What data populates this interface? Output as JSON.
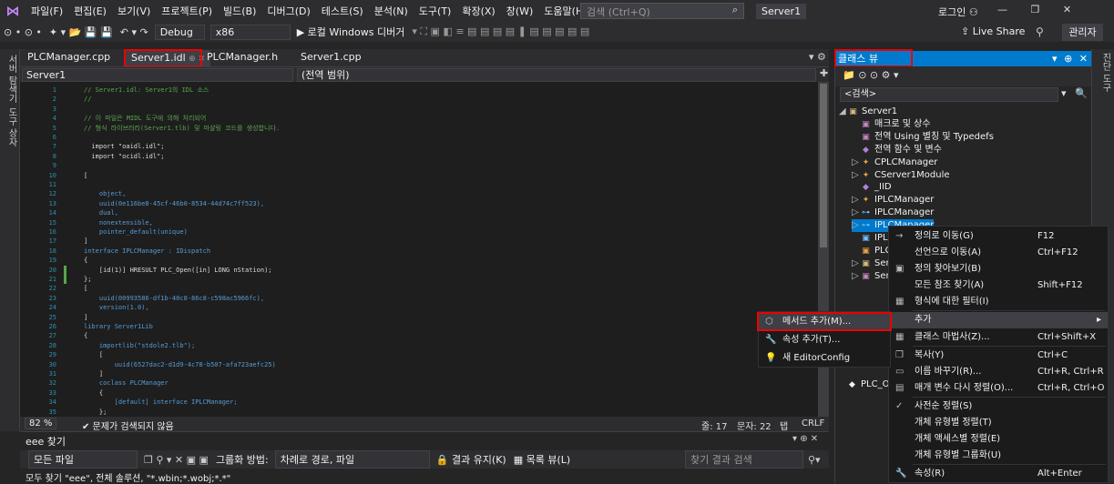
{
  "menu": {
    "logo_glyph": "⋈",
    "items": [
      "파일(F)",
      "편집(E)",
      "보기(V)",
      "프로젝트(P)",
      "빌드(B)",
      "디버그(D)",
      "테스트(S)",
      "분석(N)",
      "도구(T)",
      "확장(X)",
      "창(W)",
      "도움말(H)"
    ],
    "search_placeholder": "검색 (Ctrl+Q)",
    "project_name": "Server1",
    "login": "로그인",
    "window_controls": "— ❐ ✕"
  },
  "toolbar": {
    "nav": "⊙ • ⊙ •",
    "icons": "✦ ▾ 📂 💾 💾",
    "undo": "↶ ▾ ↷",
    "config": "Debug",
    "platform": "x86",
    "debugger": "▶ 로컬 Windows 디버거",
    "live_share": "Live Share",
    "admin": "관리자"
  },
  "left_strip": [
    "서버 탐색기",
    "도구 상자"
  ],
  "right_strip": [
    "진단 도구"
  ],
  "tabs": {
    "t1": "PLCManager.cpp",
    "t2": "Server1.idl",
    "t2_controls": "⊕ ✕",
    "t3": "PLCManager.h",
    "t4": "Server1.cpp"
  },
  "navbar": {
    "left": "Server1",
    "right": "(전역 범위)"
  },
  "code": [
    {
      "n": "1",
      "t": "// Server1.idl: Server1의 IDL 소스",
      "c": "cm"
    },
    {
      "n": "2",
      "t": "//",
      "c": "cm"
    },
    {
      "n": "3",
      "t": "",
      "c": ""
    },
    {
      "n": "4",
      "t": "// 이 파일은 MIDL 도구에 의해 처리되어",
      "c": "cm"
    },
    {
      "n": "5",
      "t": "// 형식 라이브러리(Server1.tlb) 및 마샬링 코드를 생성합니다.",
      "c": "cm"
    },
    {
      "n": "6",
      "t": "",
      "c": ""
    },
    {
      "n": "7",
      "t": "  import \"oaidl.idl\";",
      "c": ""
    },
    {
      "n": "8",
      "t": "  import \"ocidl.idl\";",
      "c": ""
    },
    {
      "n": "9",
      "t": "",
      "c": ""
    },
    {
      "n": "10",
      "t": "[",
      "c": ""
    },
    {
      "n": "11",
      "t": "",
      "c": ""
    },
    {
      "n": "12",
      "t": "    object,",
      "c": "kw"
    },
    {
      "n": "13",
      "t": "    uuid(0e116be8-45cf-46b0-8534-44d74c7ff523),",
      "c": "kw"
    },
    {
      "n": "14",
      "t": "    dual,",
      "c": "kw"
    },
    {
      "n": "15",
      "t": "    nonextensible,",
      "c": "kw"
    },
    {
      "n": "16",
      "t": "    pointer_default(unique)",
      "c": "kw"
    },
    {
      "n": "17",
      "t": "]",
      "c": ""
    },
    {
      "n": "18",
      "t": "interface IPLCManager : IDispatch",
      "c": "kw"
    },
    {
      "n": "19",
      "t": "{",
      "c": ""
    },
    {
      "n": "20",
      "t": "    [id(1)] HRESULT PLC_Open([in] LONG nStation);",
      "c": ""
    },
    {
      "n": "21",
      "t": "};",
      "c": ""
    },
    {
      "n": "22",
      "t": "[",
      "c": ""
    },
    {
      "n": "23",
      "t": "    uuid(00993586-df1b-40c8-86c8-c598ac5966fc),",
      "c": "kw"
    },
    {
      "n": "24",
      "t": "    version(1.0),",
      "c": "kw"
    },
    {
      "n": "25",
      "t": "]",
      "c": ""
    },
    {
      "n": "26",
      "t": "library Server1Lib",
      "c": "kw"
    },
    {
      "n": "27",
      "t": "{",
      "c": ""
    },
    {
      "n": "28",
      "t": "    importlib(\"stdole2.tlb\");",
      "c": "kw"
    },
    {
      "n": "29",
      "t": "    [",
      "c": ""
    },
    {
      "n": "30",
      "t": "        uuid(6527dac2-d1d9-4c78-b507-afa723aefc25)",
      "c": "kw"
    },
    {
      "n": "31",
      "t": "    ]",
      "c": ""
    },
    {
      "n": "32",
      "t": "    coclass PLCManager",
      "c": "kw"
    },
    {
      "n": "33",
      "t": "    {",
      "c": ""
    },
    {
      "n": "34",
      "t": "        [default] interface IPLCManager;",
      "c": "kw"
    },
    {
      "n": "35",
      "t": "    };",
      "c": ""
    }
  ],
  "editor_status": {
    "zoom": "82 %",
    "issues": "✔ 문제가 검색되지 않음",
    "line": "줄: 17",
    "col": "문자: 22",
    "tab": "탭",
    "eol": "CRLF"
  },
  "find": {
    "title": "eee 찾기",
    "scope": "모든 파일",
    "group_label": "그룹화 방법:",
    "group_value": "차례로 경로, 파일",
    "keep_results": "결과 유지(K)",
    "list_view": "목록 뷰(L)",
    "search_placeholder": "찾기 결과 검색",
    "result": "모두 찾기 \"eee\", 전체 솔루션, \"*.wbin;*.wobj;*.*\""
  },
  "classview": {
    "title": "클래스 뷰",
    "title_controls": "▾ ⊕ ✕",
    "toolbar": "📁 ⊙ ⊙ ⚙ ▾",
    "search": "<검색>",
    "search_btns": "▾ 🔍"
  },
  "tree": [
    {
      "label": "Server1",
      "arrow": "◢",
      "icon": "▣",
      "color": "#d7ba7d"
    },
    {
      "label": "매크로 및 상수",
      "arrow": "",
      "icon": "▣",
      "color": "#c586c0"
    },
    {
      "label": "전역 Using 별칭 및 Typedefs",
      "arrow": "",
      "icon": "▣",
      "color": "#c586c0"
    },
    {
      "label": "전역 함수 및 변수",
      "arrow": "",
      "icon": "◆",
      "color": "#b180d7"
    },
    {
      "label": "CPLCManager",
      "arrow": "▷",
      "icon": "✦",
      "color": "#e8a33d"
    },
    {
      "label": "CServer1Module",
      "arrow": "▷",
      "icon": "✦",
      "color": "#e8a33d"
    },
    {
      "label": "_IID",
      "arrow": "",
      "icon": "◆",
      "color": "#b180d7"
    },
    {
      "label": "IPLCManager",
      "arrow": "▷",
      "icon": "✦",
      "color": "#e8a33d"
    },
    {
      "label": "IPLCManager",
      "arrow": "▷",
      "icon": "⊶",
      "color": "#75beff"
    },
    {
      "label": "IPLCManager",
      "arrow": "▷",
      "icon": "⊶",
      "color": "#75beff"
    },
    {
      "label": "IPL",
      "arrow": "",
      "icon": "▣",
      "color": "#75beff"
    },
    {
      "label": "PLC",
      "arrow": "",
      "icon": "▣",
      "color": "#e8a33d"
    },
    {
      "label": "Ser",
      "arrow": "▷",
      "icon": "▣",
      "color": "#d7ba7d"
    },
    {
      "label": "Server",
      "arrow": "▷",
      "icon": "▣",
      "color": "#c586c0"
    }
  ],
  "tree_extra": {
    "label": "PLC_O",
    "icon": "◆",
    "color": "#b180d7"
  },
  "context_menu": [
    {
      "label": "정의로 이동(G)",
      "shortcut": "F12",
      "icon": "→"
    },
    {
      "label": "선언으로 이동(A)",
      "shortcut": "Ctrl+F12",
      "icon": ""
    },
    {
      "label": "정의 찾아보기(B)",
      "shortcut": "",
      "icon": "▣"
    },
    {
      "label": "모든 참조 찾기(A)",
      "shortcut": "Shift+F12",
      "icon": ""
    },
    {
      "label": "형식에 대한 필터(I)",
      "shortcut": "",
      "icon": "▦"
    },
    {
      "label": "추가",
      "shortcut": "▸",
      "icon": ""
    },
    {
      "label": "클래스 마법사(Z)...",
      "shortcut": "Ctrl+Shift+X",
      "icon": "▦"
    },
    {
      "label": "복사(Y)",
      "shortcut": "Ctrl+C",
      "icon": "❐"
    },
    {
      "label": "이름 바꾸기(R)...",
      "shortcut": "Ctrl+R, Ctrl+R",
      "icon": "▭"
    },
    {
      "label": "매개 변수 다시 정렬(O)...",
      "shortcut": "Ctrl+R, Ctrl+O",
      "icon": "▤"
    },
    {
      "label": "사전순 정렬(S)",
      "shortcut": "",
      "icon": "✓"
    },
    {
      "label": "개체 유형별 정렬(T)",
      "shortcut": "",
      "icon": ""
    },
    {
      "label": "개체 액세스별 정렬(E)",
      "shortcut": "",
      "icon": ""
    },
    {
      "label": "개체 유형별 그룹화(U)",
      "shortcut": "",
      "icon": ""
    },
    {
      "label": "속성(R)",
      "shortcut": "Alt+Enter",
      "icon": "🔧"
    }
  ],
  "submenu": [
    {
      "label": "메서드 추가(M)...",
      "icon": "⬡"
    },
    {
      "label": "속성 추가(T)...",
      "icon": "🔧"
    },
    {
      "label": "새 EditorConfig",
      "icon": "💡"
    }
  ]
}
